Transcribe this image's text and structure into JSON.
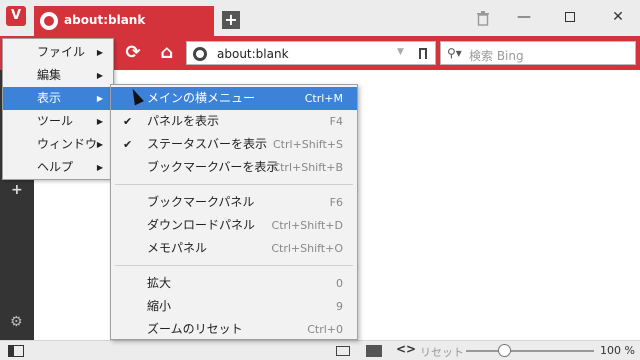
{
  "window": {
    "logo": "V",
    "minimize": "—",
    "close": "✕"
  },
  "tab": {
    "title": "about:blank",
    "new_tab": "+"
  },
  "navbar": {
    "reload": "⟳",
    "home": "⌂",
    "url": "about:blank",
    "search_placeholder": "検索 Bing",
    "search_icon": "⚲▾"
  },
  "sidebar": {
    "add": "+",
    "gear": "⚙"
  },
  "main_menu": [
    {
      "label": "ファイル"
    },
    {
      "label": "編集"
    },
    {
      "label": "表示"
    },
    {
      "label": "ツール"
    },
    {
      "label": "ウィンドウ"
    },
    {
      "label": "ヘルプ"
    }
  ],
  "view_menu": [
    {
      "label": "メインの横メニュー",
      "shortcut": "Ctrl+M"
    },
    {
      "label": "パネルを表示",
      "shortcut": "F4"
    },
    {
      "label": "ステータスバーを表示",
      "shortcut": "Ctrl+Shift+S"
    },
    {
      "label": "ブックマークバーを表示",
      "shortcut": "Ctrl+Shift+B"
    },
    {
      "label": "ブックマークパネル",
      "shortcut": "F6"
    },
    {
      "label": "ダウンロードパネル",
      "shortcut": "Ctrl+Shift+D"
    },
    {
      "label": "メモパネル",
      "shortcut": "Ctrl+Shift+O"
    },
    {
      "label": "拡大",
      "shortcut": "0"
    },
    {
      "label": "縮小",
      "shortcut": "9"
    },
    {
      "label": "ズームのリセット",
      "shortcut": "Ctrl+0"
    }
  ],
  "statusbar": {
    "code": "<>",
    "reset": "リセット",
    "zoom": "100 %",
    "zoom_level": 0.3
  },
  "colors": {
    "accent": "#d4333c",
    "menu_highlight": "#3c82d8"
  }
}
